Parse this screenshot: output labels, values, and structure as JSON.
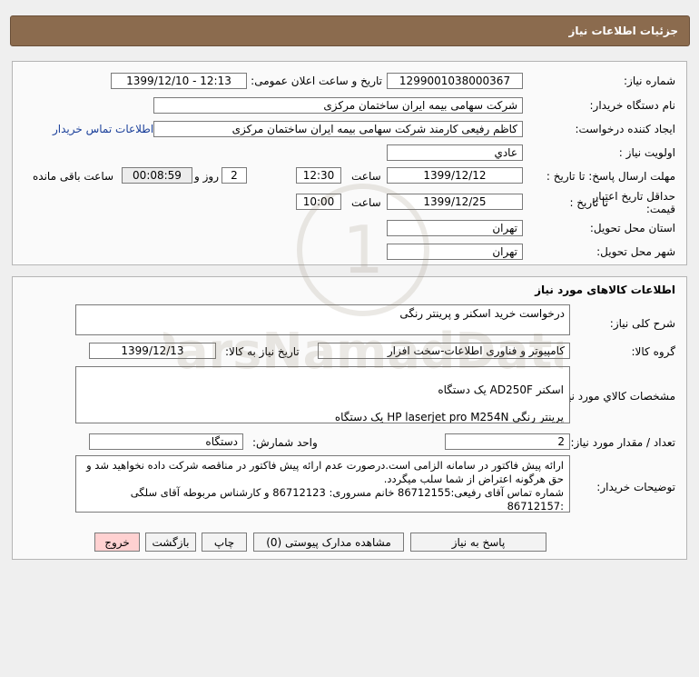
{
  "header": {
    "title": "جزئیات اطلاعات نیاز"
  },
  "need_info": {
    "need_number_label": "شماره نیاز:",
    "need_number": "1299001038000367",
    "announce_label": "تاریخ و ساعت اعلان عمومی:",
    "announce_value": "1399/12/10 - 12:13",
    "buyer_org_label": "نام دستگاه خریدار:",
    "buyer_org": "شرکت سهامی بیمه ایران ساختمان مرکزی",
    "requester_label": "ایجاد کننده درخواست:",
    "requester": "کاظم رفیعی کارمند شرکت سهامی بیمه ایران ساختمان مرکزی",
    "contact_link": "اطلاعات تماس خریدار",
    "priority_label": "اولویت نیاز :",
    "priority": "عادي",
    "deadline_label": "مهلت ارسال پاسخ: تا تاریخ :",
    "deadline_date": "1399/12/12",
    "time_label": "ساعت",
    "deadline_time": "12:30",
    "days_value": "2",
    "days_label": "روز و",
    "remaining_time": "00:08:59",
    "remaining_label": "ساعت باقی مانده",
    "validity_label_1": "حداقل تاریخ اعتبار",
    "validity_label_2": "قیمت:",
    "validity_to_label": "تا تاریخ :",
    "validity_date": "1399/12/25",
    "validity_time": "10:00",
    "province_label": "استان محل تحویل:",
    "province": "تهران",
    "city_label": "شهر محل تحویل:",
    "city": "تهران"
  },
  "goods": {
    "section_title": "اطلاعات کالاهای مورد نیاز",
    "summary_label": "شرح کلی نیاز:",
    "summary": "درخواست خرید اسکنر و پرینتر رنگی",
    "group_label": "گروه کالا:",
    "group": "کامپیوتر و فناوری اطلاعات-سخت افزار",
    "need_date_label": "تاریخ نیاز به کالا:",
    "need_date": "1399/12/13",
    "specs_label": "مشخصات کالاي مورد نياز:",
    "specs_line1": "اسکنر   AD250F    یک دستگاه",
    "specs_line2": "پرینتر رنگی   HP laserjet pro M254N    یک دستگاه",
    "quantity_label": "تعداد / مقدار مورد نیاز:",
    "quantity": "2",
    "unit_label": "واحد شمارش:",
    "unit": "دستگاه",
    "buyer_notes_label": "توضیحات خریدار:",
    "buyer_notes": "ارائه پیش فاکتور در سامانه الزامی است.درصورت عدم ارائه پیش فاکتور در مناقصه شرکت داده نخواهید شد و حق هرگونه اعتراض از شما سلب میگردد.\nشماره تماس آقای رفیعی:86712155 خانم مسروری: 86712123 و کارشناس مربوطه آقای سلگی :86712157"
  },
  "actions": {
    "respond": "پاسخ به نیاز",
    "view_docs": "مشاهده مدارک پیوستی (0)",
    "print": "چاپ",
    "back": "بازگشت",
    "exit": "خروج"
  },
  "watermark": {
    "text": "ParsNamadData"
  }
}
